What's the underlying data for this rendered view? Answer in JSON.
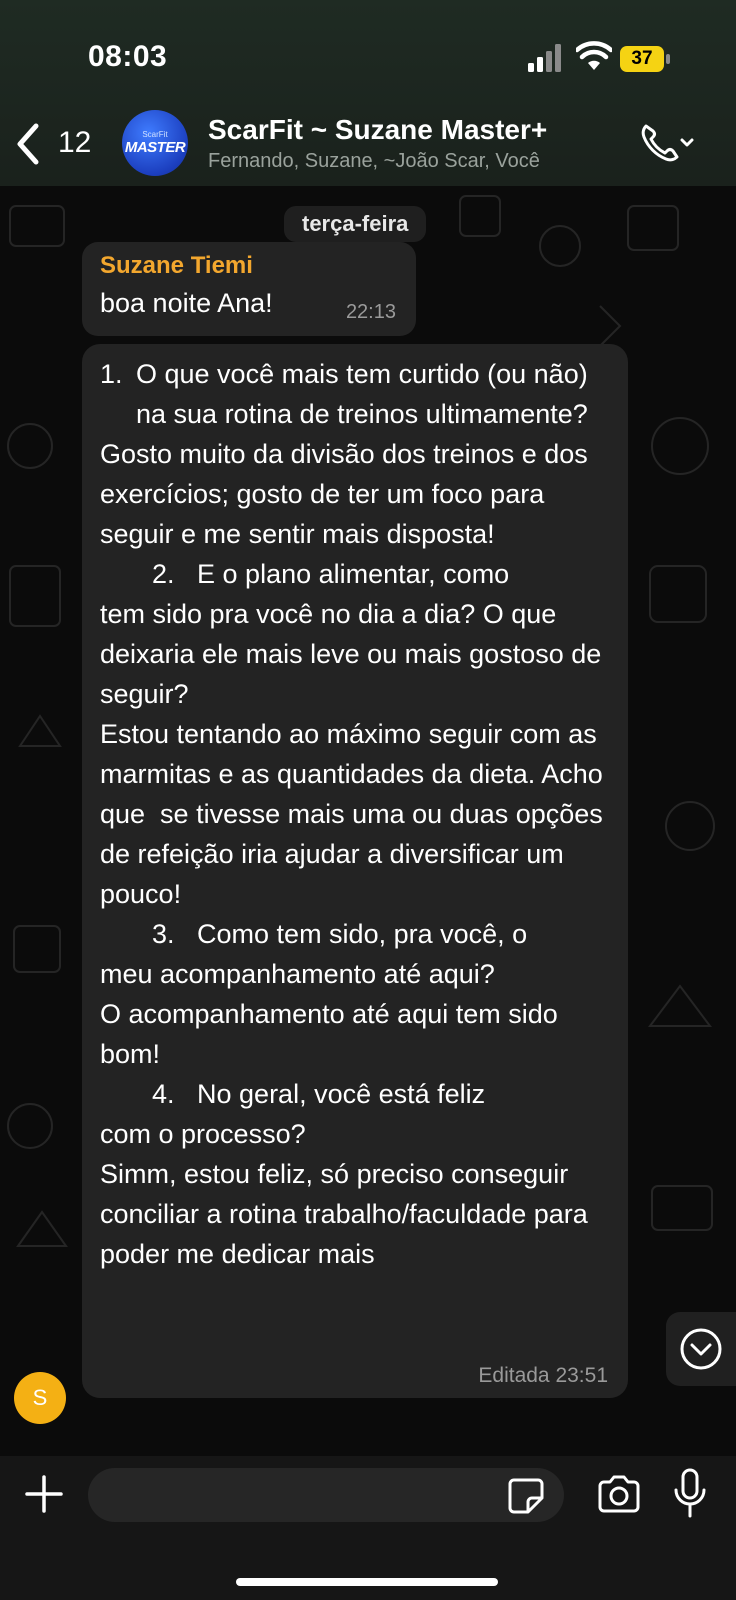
{
  "status_bar": {
    "time": "08:03",
    "battery": "37"
  },
  "header": {
    "back_count": "12",
    "avatar_text_top": "ScarFit",
    "avatar_text_main": "MASTER",
    "group_name": "ScarFit ~ Suzane Master+",
    "members": "Fernando, Suzane, ~João Scar, Você"
  },
  "chat": {
    "day_label": "terça-feira",
    "message1": {
      "sender": "Suzane Tiemi",
      "text": "boa noite Ana!",
      "time": "22:13"
    },
    "message2": {
      "q1_num": "1.",
      "q1": "O que você mais tem curtido (ou não) na sua rotina de treinos ultimamente?",
      "a1": "Gosto muito da divisão dos treinos e dos exercícios; gosto de ter um foco para seguir e me sentir mais disposta!",
      "q2_first": "2.   E o plano alimentar, como",
      "q2_rest": "tem sido pra você no dia a dia? O que deixaria ele mais leve ou mais gostoso de seguir?",
      "a2": "Estou tentando ao máximo seguir com as marmitas e as quantidades da dieta. Acho que  se tivesse mais uma ou duas opções de refeição iria ajudar a diversificar um pouco!",
      "q3_first": "3.   Como tem sido, pra você, o",
      "q3_rest": "meu acompanhamento até aqui?",
      "a3": "O acompanhamento até aqui tem sido bom!",
      "q4_first": "4.   No geral, você está feliz",
      "q4_rest": "com o processo?",
      "a4": "Simm, estou feliz, só preciso conseguir conciliar a rotina trabalho/faculdade para poder me dedicar mais",
      "edited_time": "Editada 23:51"
    },
    "sender_avatar": "S"
  },
  "colors": {
    "sender_name": "#f3a72e",
    "bubble": "#232323",
    "avatar_s": "#f4b014"
  }
}
